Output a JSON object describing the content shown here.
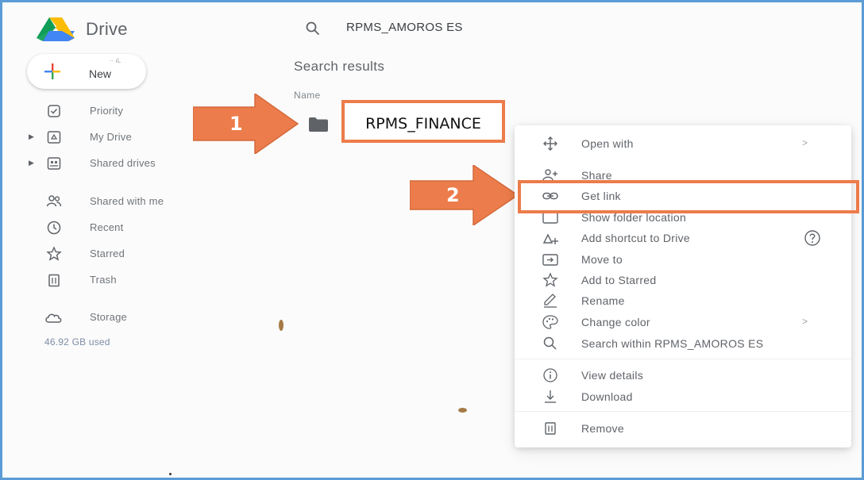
{
  "header": {
    "app_title": "Drive",
    "search_query": "RPMS_AMOROS ES"
  },
  "new_button": {
    "label": "New",
    "tiny_text": "·· ıL"
  },
  "sidebar": {
    "items": [
      {
        "label": "Priority",
        "icon": "priority-icon"
      },
      {
        "label": "My Drive",
        "icon": "my-drive-icon"
      },
      {
        "label": "Shared drives",
        "icon": "shared-drives-icon"
      },
      {
        "label": "Shared with me",
        "icon": "shared-with-me-icon"
      },
      {
        "label": "Recent",
        "icon": "clock-icon"
      },
      {
        "label": "Starred",
        "icon": "star-icon"
      },
      {
        "label": "Trash",
        "icon": "trash-icon"
      },
      {
        "label": "Storage",
        "icon": "cloud-icon"
      }
    ],
    "storage_used": "46.92 GB used"
  },
  "main": {
    "results_title": "Search results",
    "column_name": "Name",
    "folder_name": "RPMS_FINANCE"
  },
  "callouts": {
    "step1": "1",
    "step2": "2"
  },
  "context_menu": {
    "items": [
      {
        "label": "Open with",
        "icon": "open-with-icon",
        "submenu": true
      },
      {
        "label": "Share",
        "icon": "share-icon"
      },
      {
        "label": "Get link",
        "icon": "link-icon"
      },
      {
        "label": "Show folder location",
        "icon": "folder-location-icon"
      },
      {
        "label": "Add shortcut to Drive",
        "icon": "add-shortcut-icon",
        "help": true
      },
      {
        "label": "Move to",
        "icon": "move-to-icon"
      },
      {
        "label": "Add to Starred",
        "icon": "star-icon"
      },
      {
        "label": "Rename",
        "icon": "rename-icon"
      },
      {
        "label": "Change color",
        "icon": "palette-icon",
        "submenu": true
      },
      {
        "label": "Search within RPMS_AMOROS ES",
        "icon": "search-icon"
      },
      {
        "label": "View details",
        "icon": "info-icon"
      },
      {
        "label": "Download",
        "icon": "download-icon"
      },
      {
        "label": "Remove",
        "icon": "trash-icon"
      }
    ],
    "chevron": ">"
  },
  "colors": {
    "callout_orange": "#ec7c4b",
    "frame_blue": "#5b9bd5"
  }
}
